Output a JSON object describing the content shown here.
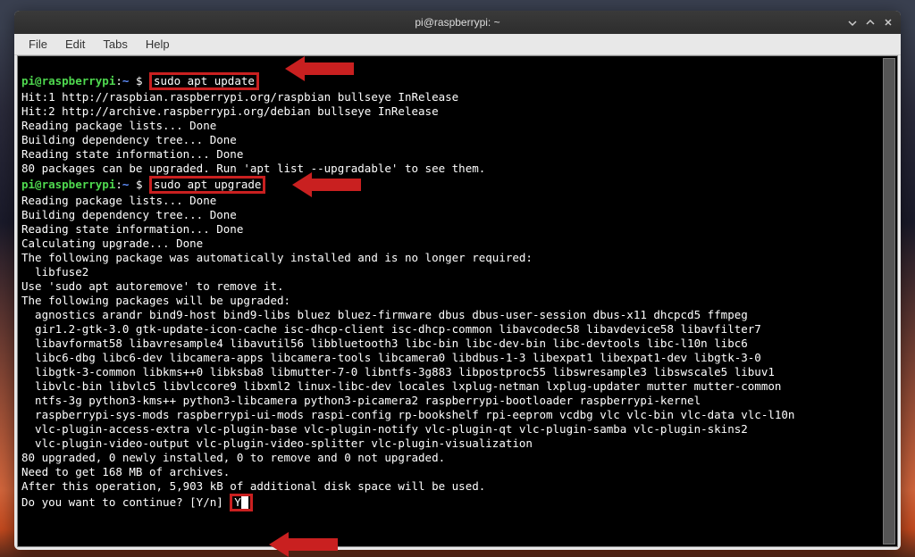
{
  "window": {
    "title": "pi@raspberrypi: ~"
  },
  "menu": {
    "file": "File",
    "edit": "Edit",
    "tabs": "Tabs",
    "help": "Help"
  },
  "prompt": {
    "user": "pi@raspberrypi",
    "path": "~",
    "symbol": "$"
  },
  "commands": {
    "update": "sudo apt update",
    "upgrade": "sudo apt upgrade",
    "continue_answer": "Y"
  },
  "output": {
    "l1": "Hit:1 http://raspbian.raspberrypi.org/raspbian bullseye InRelease",
    "l2": "Hit:2 http://archive.raspberrypi.org/debian bullseye InRelease",
    "l3": "Reading package lists... Done",
    "l4": "Building dependency tree... Done",
    "l5": "Reading state information... Done",
    "l6": "80 packages can be upgraded. Run 'apt list --upgradable' to see them.",
    "l7": "Reading package lists... Done",
    "l8": "Building dependency tree... Done",
    "l9": "Reading state information... Done",
    "l10": "Calculating upgrade... Done",
    "l11": "The following package was automatically installed and is no longer required:",
    "l12": "  libfuse2",
    "l13": "Use 'sudo apt autoremove' to remove it.",
    "l14": "The following packages will be upgraded:",
    "l15": "  agnostics arandr bind9-host bind9-libs bluez bluez-firmware dbus dbus-user-session dbus-x11 dhcpcd5 ffmpeg",
    "l16": "  gir1.2-gtk-3.0 gtk-update-icon-cache isc-dhcp-client isc-dhcp-common libavcodec58 libavdevice58 libavfilter7",
    "l17": "  libavformat58 libavresample4 libavutil56 libbluetooth3 libc-bin libc-dev-bin libc-devtools libc-l10n libc6",
    "l18": "  libc6-dbg libc6-dev libcamera-apps libcamera-tools libcamera0 libdbus-1-3 libexpat1 libexpat1-dev libgtk-3-0",
    "l19": "  libgtk-3-common libkms++0 libksba8 libmutter-7-0 libntfs-3g883 libpostproc55 libswresample3 libswscale5 libuv1",
    "l20": "  libvlc-bin libvlc5 libvlccore9 libxml2 linux-libc-dev locales lxplug-netman lxplug-updater mutter mutter-common",
    "l21": "  ntfs-3g python3-kms++ python3-libcamera python3-picamera2 raspberrypi-bootloader raspberrypi-kernel",
    "l22": "  raspberrypi-sys-mods raspberrypi-ui-mods raspi-config rp-bookshelf rpi-eeprom vcdbg vlc vlc-bin vlc-data vlc-l10n",
    "l23": "  vlc-plugin-access-extra vlc-plugin-base vlc-plugin-notify vlc-plugin-qt vlc-plugin-samba vlc-plugin-skins2",
    "l24": "  vlc-plugin-video-output vlc-plugin-video-splitter vlc-plugin-visualization",
    "l25": "80 upgraded, 0 newly installed, 0 to remove and 0 not upgraded.",
    "l26": "Need to get 168 MB of archives.",
    "l27": "After this operation, 5,903 kB of additional disk space will be used.",
    "l28": "Do you want to continue? [Y/n] "
  }
}
